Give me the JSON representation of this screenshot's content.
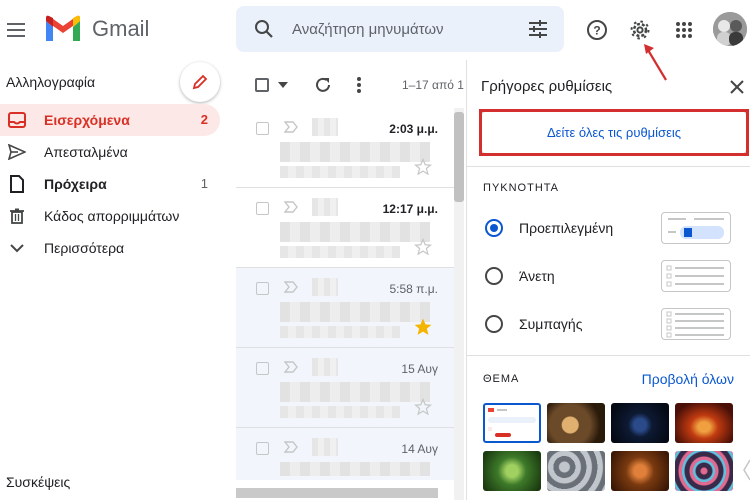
{
  "header": {
    "app_name": "Gmail",
    "search_placeholder": "Αναζήτηση μηνυμάτων"
  },
  "sidebar": {
    "compose_label": "Αλληλογραφία",
    "items": [
      {
        "label": "Εισερχόμενα",
        "count": "2",
        "icon": "inbox-icon"
      },
      {
        "label": "Απεσταλμένα",
        "count": "",
        "icon": "send-icon"
      },
      {
        "label": "Πρόχειρα",
        "count": "1",
        "icon": "draft-icon"
      },
      {
        "label": "Κάδος απορριμμάτων",
        "count": "",
        "icon": "trash-icon"
      },
      {
        "label": "Περισσότερα",
        "count": "",
        "icon": "chevron-down-icon"
      }
    ],
    "meet_label": "Συσκέψεις"
  },
  "mail_list": {
    "range": "1–17 από 1",
    "rows": [
      {
        "time": "2:03 μ.μ.",
        "unread": true,
        "starred": false
      },
      {
        "time": "12:17 μ.μ.",
        "unread": true,
        "starred": false
      },
      {
        "time": "5:58 π.μ.",
        "unread": false,
        "starred": true
      },
      {
        "time": "15 Αυγ",
        "unread": false,
        "starred": false
      },
      {
        "time": "14 Αυγ",
        "unread": false,
        "starred": false
      }
    ]
  },
  "quick_settings": {
    "title": "Γρήγορες ρυθμίσεις",
    "see_all_button": "Δείτε όλες τις ρυθμίσεις",
    "density_heading": "ΠΥΚΝΟΤΗΤΑ",
    "density_options": [
      {
        "label": "Προεπιλεγμένη",
        "selected": true
      },
      {
        "label": "Άνετη",
        "selected": false
      },
      {
        "label": "Συμπαγής",
        "selected": false
      }
    ],
    "theme_heading": "ΘΕΜΑ",
    "view_all": "Προβολή όλων",
    "themes": [
      {
        "name": "default",
        "color": "#ffffff"
      },
      {
        "name": "chess",
        "color": "#6b4a2a"
      },
      {
        "name": "space",
        "color": "#0d1a33"
      },
      {
        "name": "fire",
        "color": "#8a2a12"
      },
      {
        "name": "leaf",
        "color": "#3e7a2a"
      },
      {
        "name": "bubbles",
        "color": "#8a9099"
      },
      {
        "name": "autumn",
        "color": "#7a3a10"
      },
      {
        "name": "lights",
        "color": "#3a2a4a"
      }
    ]
  },
  "colors": {
    "accent_red": "#d93025",
    "link_blue": "#0b57d0",
    "highlight_red": "#d32f2f"
  }
}
